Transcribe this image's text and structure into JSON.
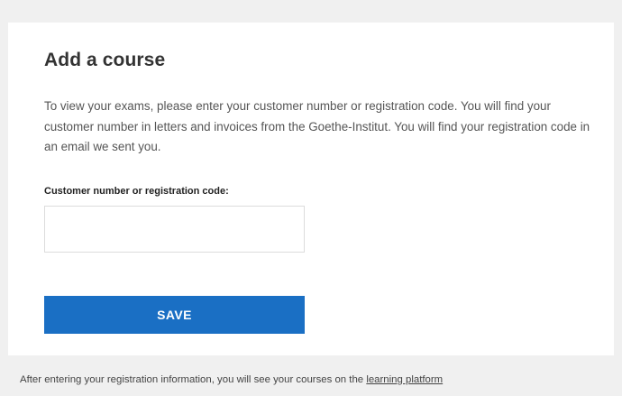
{
  "card": {
    "title": "Add a course",
    "intro": "To view your exams, please enter your customer number or registration code. You will find your customer number in letters and invoices from the Goethe-Institut. You will find your registration code in an email we sent you.",
    "field_label": "Customer number or registration code:",
    "field_value": "",
    "save_label": "SAVE"
  },
  "footer": {
    "text": "After entering your registration information, you will see your courses on the ",
    "link_label": "learning platform"
  },
  "colors": {
    "background": "#f0f0f0",
    "card": "#ffffff",
    "primary_button": "#1a6fc4"
  }
}
